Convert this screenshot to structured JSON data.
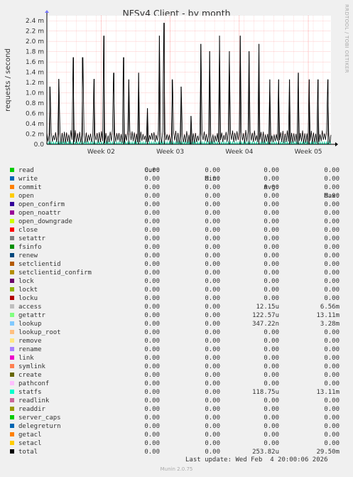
{
  "chart_data": {
    "type": "line",
    "title": "NFSv4 Client - by month",
    "ylabel": "requests / second",
    "side_label": "RRDTOOL / TOBI OETIKER",
    "ylim": [
      0,
      0.0025
    ],
    "y_ticks": [
      "0.0",
      "0.2 m",
      "0.4 m",
      "0.6 m",
      "0.8 m",
      "1.0 m",
      "1.2 m",
      "1.4 m",
      "1.6 m",
      "1.8 m",
      "2.0 m",
      "2.2 m",
      "2.4 m"
    ],
    "x_ticks": [
      "Week 02",
      "Week 03",
      "Week 04",
      "Week 05"
    ],
    "grid": true,
    "spike_days": [
      0.3,
      1.2,
      2.7,
      3.6,
      4.8,
      5.8,
      6.8,
      7.8,
      8.3,
      9.3,
      10.2,
      11.4,
      11.9,
      12.7,
      13.6,
      14.6,
      15.6,
      16.5,
      17.5,
      18.5,
      19.6,
      20.5,
      21.5,
      22.6,
      23.5,
      24.6,
      25.5,
      26.6,
      27.5,
      28.5
    ],
    "spike_values": [
      0.00112,
      0.00127,
      0.00169,
      0.00169,
      0.00127,
      0.00211,
      0.00139,
      0.00169,
      0.00126,
      0.00139,
      0.0007,
      0.00211,
      0.00236,
      0.00126,
      0.00112,
      0.00055,
      0.00195,
      0.00181,
      0.00211,
      0.00181,
      0.00211,
      0.00181,
      0.00195,
      0.00126,
      0.00126,
      0.00126,
      0.00139,
      0.00126,
      0.00126,
      0.00126
    ],
    "series_colors": {
      "total": "#000000",
      "statfs": "#00cc99"
    }
  },
  "legend": {
    "headers": {
      "cur": "Cur:",
      "min": "Min:",
      "avg": "Avg:",
      "max": "Max:"
    },
    "rows": [
      {
        "name": "read",
        "color": "#00cc00",
        "cur": "0.00",
        "min": "0.00",
        "avg": "0.00",
        "max": "0.00"
      },
      {
        "name": "write",
        "color": "#0066b3",
        "cur": "0.00",
        "min": "0.00",
        "avg": "0.00",
        "max": "0.00"
      },
      {
        "name": "commit",
        "color": "#ff8000",
        "cur": "0.00",
        "min": "0.00",
        "avg": "0.00",
        "max": "0.00"
      },
      {
        "name": "open",
        "color": "#ffcc00",
        "cur": "0.00",
        "min": "0.00",
        "avg": "0.00",
        "max": "0.00"
      },
      {
        "name": "open_confirm",
        "color": "#330099",
        "cur": "0.00",
        "min": "0.00",
        "avg": "0.00",
        "max": "0.00"
      },
      {
        "name": "open_noattr",
        "color": "#990099",
        "cur": "0.00",
        "min": "0.00",
        "avg": "0.00",
        "max": "0.00"
      },
      {
        "name": "open_downgrade",
        "color": "#ccff00",
        "cur": "0.00",
        "min": "0.00",
        "avg": "0.00",
        "max": "0.00"
      },
      {
        "name": "close",
        "color": "#ff0000",
        "cur": "0.00",
        "min": "0.00",
        "avg": "0.00",
        "max": "0.00"
      },
      {
        "name": "setattr",
        "color": "#808080",
        "cur": "0.00",
        "min": "0.00",
        "avg": "0.00",
        "max": "0.00"
      },
      {
        "name": "fsinfo",
        "color": "#008f00",
        "cur": "0.00",
        "min": "0.00",
        "avg": "0.00",
        "max": "0.00"
      },
      {
        "name": "renew",
        "color": "#00487d",
        "cur": "0.00",
        "min": "0.00",
        "avg": "0.00",
        "max": "0.00"
      },
      {
        "name": "setclientid",
        "color": "#b35a00",
        "cur": "0.00",
        "min": "0.00",
        "avg": "0.00",
        "max": "0.00"
      },
      {
        "name": "setclientid_confirm",
        "color": "#b38f00",
        "cur": "0.00",
        "min": "0.00",
        "avg": "0.00",
        "max": "0.00"
      },
      {
        "name": "lock",
        "color": "#6b006b",
        "cur": "0.00",
        "min": "0.00",
        "avg": "0.00",
        "max": "0.00"
      },
      {
        "name": "lockt",
        "color": "#8fb300",
        "cur": "0.00",
        "min": "0.00",
        "avg": "0.00",
        "max": "0.00"
      },
      {
        "name": "locku",
        "color": "#b30000",
        "cur": "0.00",
        "min": "0.00",
        "avg": "0.00",
        "max": "0.00"
      },
      {
        "name": "access",
        "color": "#bebebe",
        "cur": "0.00",
        "min": "0.00",
        "avg": "12.15u",
        "max": "6.56m"
      },
      {
        "name": "getattr",
        "color": "#80ff80",
        "cur": "0.00",
        "min": "0.00",
        "avg": "122.57u",
        "max": "13.11m"
      },
      {
        "name": "lookup",
        "color": "#80c9ff",
        "cur": "0.00",
        "min": "0.00",
        "avg": "347.22n",
        "max": "3.28m"
      },
      {
        "name": "lookup_root",
        "color": "#ffc080",
        "cur": "0.00",
        "min": "0.00",
        "avg": "0.00",
        "max": "0.00"
      },
      {
        "name": "remove",
        "color": "#ffe680",
        "cur": "0.00",
        "min": "0.00",
        "avg": "0.00",
        "max": "0.00"
      },
      {
        "name": "rename",
        "color": "#aa80ff",
        "cur": "0.00",
        "min": "0.00",
        "avg": "0.00",
        "max": "0.00"
      },
      {
        "name": "link",
        "color": "#ee00cc",
        "cur": "0.00",
        "min": "0.00",
        "avg": "0.00",
        "max": "0.00"
      },
      {
        "name": "symlink",
        "color": "#ff8050",
        "cur": "0.00",
        "min": "0.00",
        "avg": "0.00",
        "max": "0.00"
      },
      {
        "name": "create",
        "color": "#666600",
        "cur": "0.00",
        "min": "0.00",
        "avg": "0.00",
        "max": "0.00"
      },
      {
        "name": "pathconf",
        "color": "#ffbfff",
        "cur": "0.00",
        "min": "0.00",
        "avg": "0.00",
        "max": "0.00"
      },
      {
        "name": "statfs",
        "color": "#00ffcc",
        "cur": "0.00",
        "min": "0.00",
        "avg": "118.75u",
        "max": "13.11m"
      },
      {
        "name": "readlink",
        "color": "#cc6699",
        "cur": "0.00",
        "min": "0.00",
        "avg": "0.00",
        "max": "0.00"
      },
      {
        "name": "readdir",
        "color": "#999900",
        "cur": "0.00",
        "min": "0.00",
        "avg": "0.00",
        "max": "0.00"
      },
      {
        "name": "server_caps",
        "color": "#00cc00",
        "cur": "0.00",
        "min": "0.00",
        "avg": "0.00",
        "max": "0.00"
      },
      {
        "name": "delegreturn",
        "color": "#0066b3",
        "cur": "0.00",
        "min": "0.00",
        "avg": "0.00",
        "max": "0.00"
      },
      {
        "name": "getacl",
        "color": "#ff8000",
        "cur": "0.00",
        "min": "0.00",
        "avg": "0.00",
        "max": "0.00"
      },
      {
        "name": "setacl",
        "color": "#ffcc00",
        "cur": "0.00",
        "min": "0.00",
        "avg": "0.00",
        "max": "0.00"
      },
      {
        "name": "total",
        "color": "#000000",
        "cur": "0.00",
        "min": "0.00",
        "avg": "253.82u",
        "max": "29.50m"
      }
    ]
  },
  "last_update": "Last update: Wed Feb  4 20:00:06 2026",
  "footer": "Munin 2.0.75"
}
